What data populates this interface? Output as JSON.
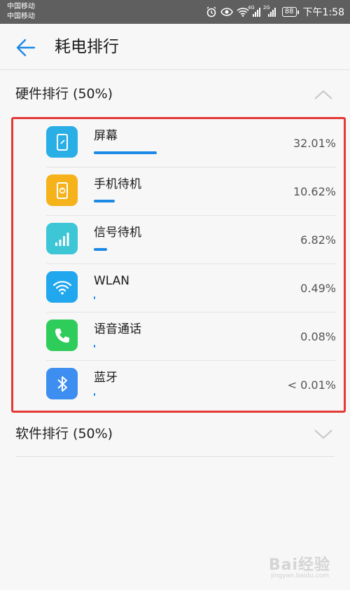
{
  "status_bar": {
    "carrier_1": "中国移动",
    "carrier_2": "中国移动",
    "network_1": "4G",
    "network_2": "2G",
    "battery": "88",
    "time": "下午1:58",
    "background_color": "#5f5f5f"
  },
  "appbar": {
    "title": "耗电排行",
    "back_icon": "arrow-left-icon",
    "accent_color": "#1e88e5"
  },
  "hardware_section": {
    "label": "硬件排行 (50%)",
    "expanded": true,
    "chevron_icon": "chevron-up-icon",
    "items": [
      {
        "name": "屏幕",
        "percent": "32.01%",
        "usage_fraction": 0.3201,
        "icon": "screen-icon",
        "icon_color": "#29aee6"
      },
      {
        "name": "手机待机",
        "percent": "10.62%",
        "usage_fraction": 0.1062,
        "icon": "phone-standby-icon",
        "icon_color": "#f5b21a"
      },
      {
        "name": "信号待机",
        "percent": "6.82%",
        "usage_fraction": 0.0682,
        "icon": "signal-bars-icon",
        "icon_color": "#3cc6d6"
      },
      {
        "name": "WLAN",
        "percent": "0.49%",
        "usage_fraction": 0.0049,
        "icon": "wifi-icon",
        "icon_color": "#21a7ee"
      },
      {
        "name": "语音通话",
        "percent": "0.08%",
        "usage_fraction": 0.0008,
        "icon": "phone-call-icon",
        "icon_color": "#2ecc5a"
      },
      {
        "name": "蓝牙",
        "percent": "< 0.01%",
        "usage_fraction": 0.0001,
        "icon": "bluetooth-icon",
        "icon_color": "#3d8ef0"
      }
    ]
  },
  "software_section": {
    "label": "软件排行 (50%)",
    "expanded": false,
    "chevron_icon": "chevron-down-icon"
  },
  "highlight_color": "#e53935",
  "watermark": {
    "text": "Bai经验",
    "sub": "jingyan.baidu.com"
  }
}
